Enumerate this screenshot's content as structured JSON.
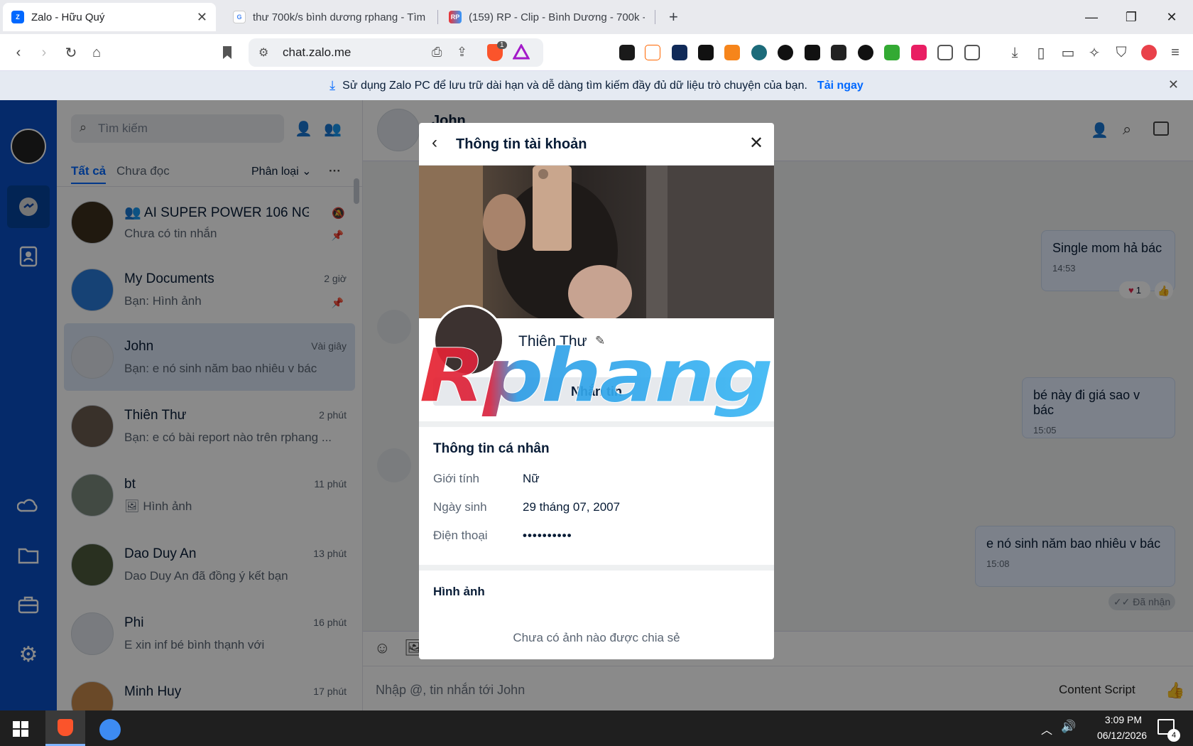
{
  "browser": {
    "tabs": [
      {
        "title": "Zalo - Hữu Quý"
      },
      {
        "title": "thư 700k/s bình dương rphang - Tìm"
      },
      {
        "title": "(159) RP - Clip - Bình Dương - 700k -"
      }
    ],
    "url": "chat.zalo.me",
    "brave_badge": "1"
  },
  "notice": {
    "text": "Sử dụng Zalo PC để lưu trữ dài hạn và dễ dàng tìm kiếm đầy đủ dữ liệu trò chuyện của bạn.",
    "link": "Tải ngay"
  },
  "sidebar": {
    "search_placeholder": "Tìm kiếm",
    "filters": {
      "all": "Tất cả",
      "unread": "Chưa đọc",
      "classify": "Phân loại"
    },
    "conversations": [
      {
        "name": "AI SUPER POWER 106 NG...",
        "preview": "Chưa có tin nhắn",
        "time": ""
      },
      {
        "name": "My Documents",
        "preview": "Bạn: Hình ảnh",
        "time": "2 giờ"
      },
      {
        "name": "John",
        "preview": "Bạn: e nó sinh năm bao nhiêu v bác",
        "time": "Vài giây"
      },
      {
        "name": "Thiên Thư",
        "preview": "Bạn: e có bài report nào trên rphang ...",
        "time": "2 phút"
      },
      {
        "name": "bt",
        "preview": "Hình ảnh",
        "time": "11 phút"
      },
      {
        "name": "Dao Duy An",
        "preview": "Dao Duy An đã đồng ý kết bạn",
        "time": "13 phút"
      },
      {
        "name": "Phi",
        "preview": "E xin inf bé bình thạnh với",
        "time": "16 phút"
      },
      {
        "name": "Minh Huy",
        "preview": "",
        "time": "17 phút"
      }
    ]
  },
  "chat": {
    "contact": "John",
    "messages": [
      {
        "text": "Single mom hả bác",
        "time": "14:53",
        "reaction_count": "1"
      },
      {
        "text": "bé này đi giá sao v bác",
        "time": "15:05"
      },
      {
        "text": "e nó sinh năm bao nhiêu v bác",
        "time": "15:08"
      }
    ],
    "received": "Đã nhận",
    "input_placeholder": "Nhập @, tin nhắn tới John",
    "content_script": "Content Script"
  },
  "modal": {
    "title": "Thông tin tài khoản",
    "name": "Thiên Thư",
    "message_button": "Nhắn tin",
    "personal_info_title": "Thông tin cá nhân",
    "fields": [
      {
        "label": "Giới tính",
        "value": "Nữ"
      },
      {
        "label": "Ngày sinh",
        "value": "29 tháng 07, 2007"
      },
      {
        "label": "Điện thoại",
        "value": "••••••••••"
      }
    ],
    "photos_title": "Hình ảnh",
    "photos_empty": "Chưa có ảnh nào được chia sẻ"
  },
  "watermark": "Rphang",
  "taskbar": {
    "time": "3:09 PM",
    "date": "06/12/2026",
    "notifications": "4"
  },
  "colors": {
    "zalo_blue": "#0068ff",
    "nav_blue": "#0a4fc4",
    "bubble": "#e5efff"
  }
}
